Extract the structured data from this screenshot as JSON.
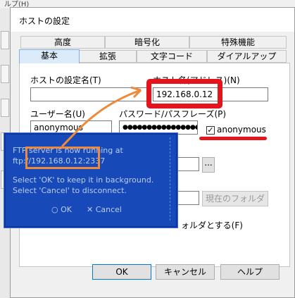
{
  "background": {
    "menu_fragment": "ルプ(H)"
  },
  "dialog": {
    "title": "ホストの設定",
    "tabs_row1": [
      "高度",
      "暗号化",
      "特殊機能"
    ],
    "tabs_row2": [
      "基本",
      "拡張",
      "文字コード",
      "ダイアルアップ"
    ],
    "active_tab": "基本",
    "host_name_label": "ホストの設定名(T)",
    "host_name_value": "",
    "host_address_label": "ホスト名(アドレス)(N)",
    "host_address_value": "192.168.0.12",
    "user_label": "ユーザー名(U)",
    "user_value": "anonymous",
    "password_label": "パスワード/パスフレーズ(P)",
    "password_value": "●●●●●●●●●●●●●●●●",
    "anonymous_label": "anonymous",
    "anonymous_checked": true,
    "browse_button": "...",
    "current_folder_button": "現在のフォルダ",
    "init_folder_label": "ォルダとする(F)",
    "ok_button": "OK",
    "cancel_button": "キャンセル",
    "help_button": "ヘルプ"
  },
  "popup": {
    "line1": "FTP server is now running at",
    "line2": "ftp://192.168.0.12:2337",
    "line3": "Select 'OK' to keep it in background.",
    "line4": "Select 'Cancel' to disconnect.",
    "ok_button": "○ OK",
    "cancel_button": "✕ Cancel"
  },
  "annotation_colors": {
    "red": "#e4141d",
    "orange": "#ee8a3c"
  }
}
